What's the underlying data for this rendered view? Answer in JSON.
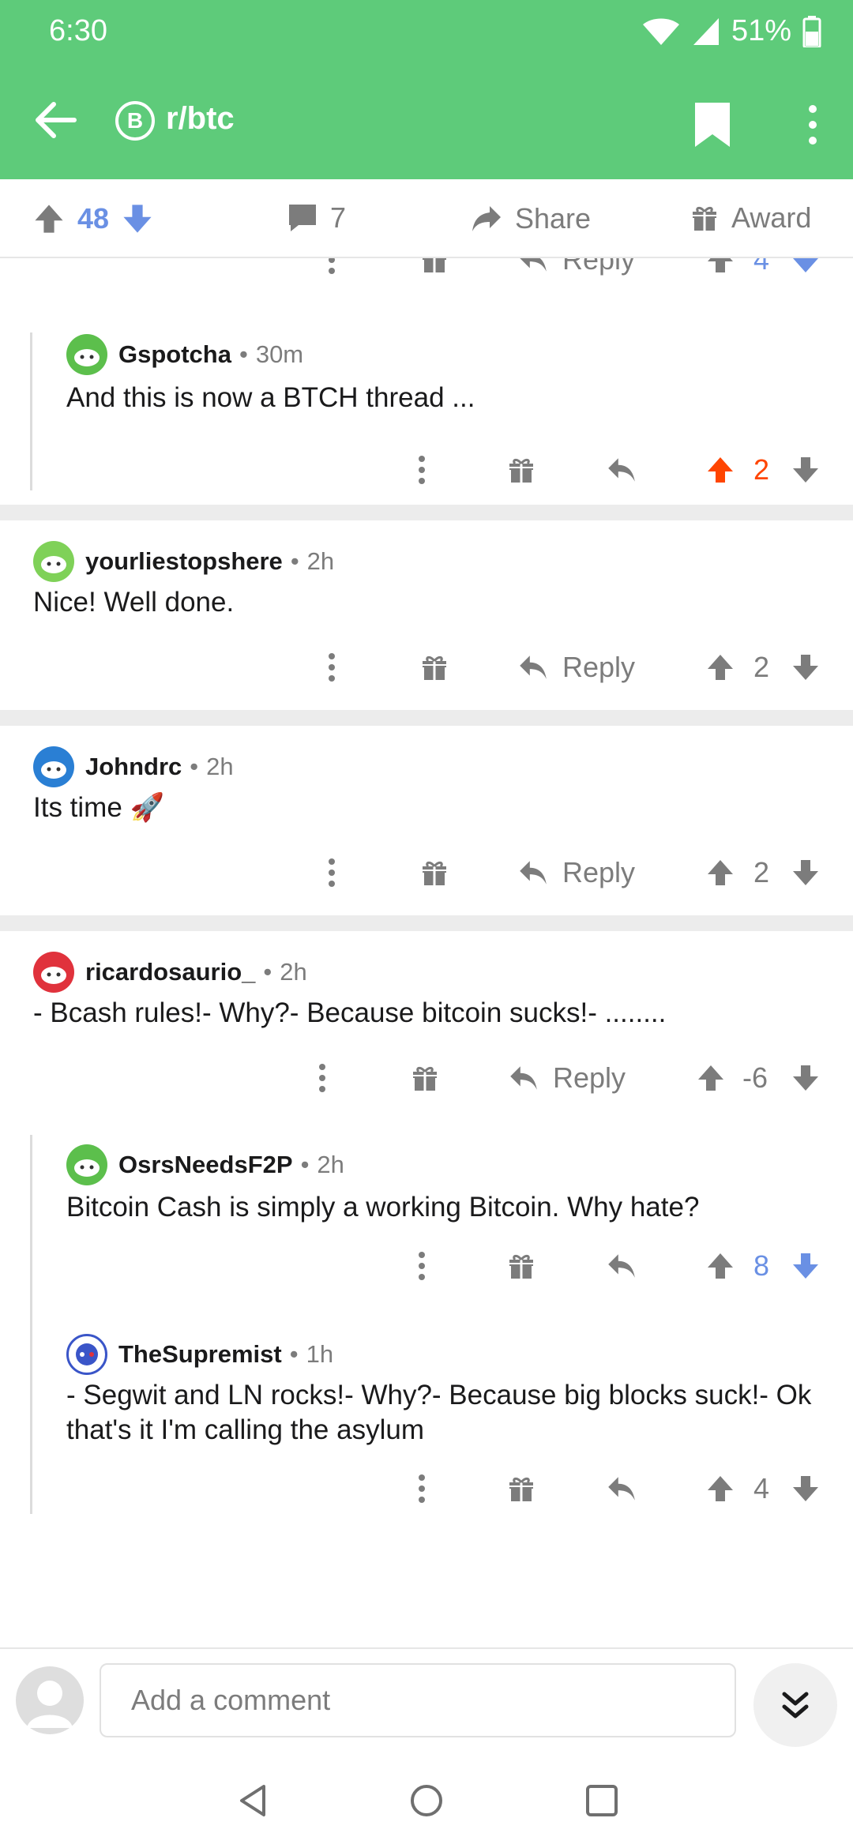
{
  "status": {
    "time": "6:30",
    "battery": "51%"
  },
  "appbar": {
    "subreddit": "r/btc",
    "badge_letter": "B",
    "brand_color": "#5ecb7a"
  },
  "post_bar": {
    "score": "48",
    "comments": "7",
    "share_label": "Share",
    "award_label": "Award"
  },
  "colors": {
    "upvote_blue": "#6a90e4",
    "upvote_orange": "#ff4500",
    "meta_gray": "#7c7c7c"
  },
  "top_partial": {
    "reply_label": "Reply",
    "score": "4"
  },
  "comments": [
    {
      "user": "Gspotcha",
      "age": "30m",
      "body": "And this is now a BTCH thread ...",
      "score": "2"
    },
    {
      "user": "yourliestopshere",
      "age": "2h",
      "body": "Nice!  Well done.",
      "reply_label": "Reply",
      "score": "2"
    },
    {
      "user": "Johndrc",
      "age": "2h",
      "body": "Its time 🚀",
      "reply_label": "Reply",
      "score": "2"
    },
    {
      "user": "ricardosaurio_",
      "age": "2h",
      "body": "- Bcash rules!- Why?- Because bitcoin sucks!- ........",
      "reply_label": "Reply",
      "score": "-6"
    },
    {
      "user": "OsrsNeedsF2P",
      "age": "2h",
      "body": "Bitcoin Cash is simply a working Bitcoin. Why hate?",
      "score": "8"
    },
    {
      "user": "TheSupremist",
      "age": "1h",
      "body": "- Segwit and LN rocks!- Why?- Because big blocks suck!- Ok that's it I'm calling the asylum",
      "score": "4"
    }
  ],
  "composer": {
    "placeholder": "Add a comment"
  },
  "separator_dot": "•"
}
